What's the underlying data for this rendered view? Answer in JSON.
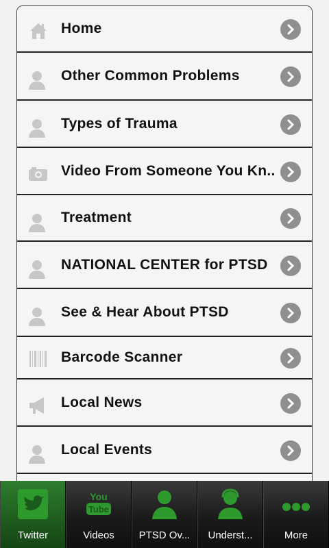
{
  "menu": {
    "items": [
      {
        "label": "Home",
        "icon": "home-icon"
      },
      {
        "label": "Other Common Problems",
        "icon": "person-icon"
      },
      {
        "label": "Types of Trauma",
        "icon": "person-icon"
      },
      {
        "label": "Video From Someone You Kn...",
        "icon": "camera-icon"
      },
      {
        "label": "Treatment",
        "icon": "person-icon"
      },
      {
        "label": "NATIONAL CENTER for PTSD",
        "icon": "person-icon"
      },
      {
        "label": "See & Hear About PTSD",
        "icon": "person-icon"
      },
      {
        "label": "Barcode Scanner",
        "icon": "barcode-icon"
      },
      {
        "label": "Local News",
        "icon": "megaphone-icon"
      },
      {
        "label": "Local Events",
        "icon": "person-icon"
      }
    ]
  },
  "tabbar": {
    "tabs": [
      {
        "label": "Twitter",
        "icon": "twitter-icon"
      },
      {
        "label": "Videos",
        "icon": "youtube-icon"
      },
      {
        "label": "PTSD Ov...",
        "icon": "person-icon"
      },
      {
        "label": "Underst...",
        "icon": "person-headset-icon"
      },
      {
        "label": "More",
        "icon": "more-dots-icon"
      }
    ]
  },
  "colors": {
    "accent_green": "#2e9a2e",
    "tab_active": "#1f5e1f",
    "chevron_gray": "#8f8f8f",
    "row_bg": "#f5f5f5"
  }
}
